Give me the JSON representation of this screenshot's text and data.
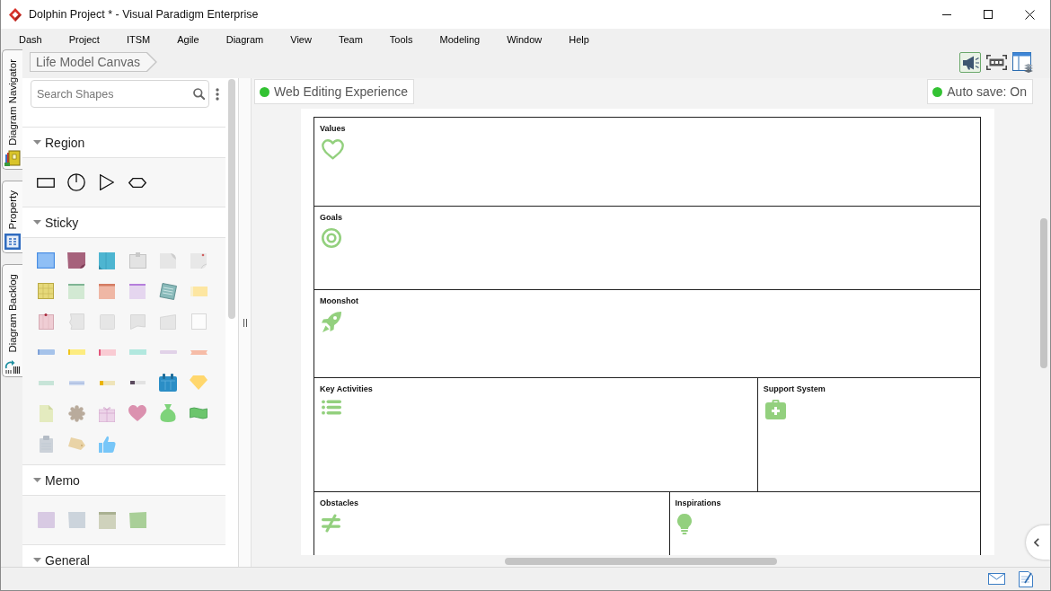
{
  "window": {
    "title": "Dolphin Project * - Visual Paradigm Enterprise"
  },
  "menu": [
    "Dash",
    "Project",
    "ITSM",
    "Agile",
    "Diagram",
    "View",
    "Team",
    "Tools",
    "Modeling",
    "Window",
    "Help"
  ],
  "side_tabs": [
    {
      "label": "Diagram Navigator",
      "selected": false
    },
    {
      "label": "Property",
      "selected": false
    },
    {
      "label": "Diagram Backlog",
      "selected": false
    }
  ],
  "breadcrumb": [
    "Life Model Canvas"
  ],
  "toolbar": [
    {
      "on": true
    },
    {
      "on": false
    },
    {
      "on": false
    }
  ],
  "palette": {
    "search": {
      "placeholder": "Search Shapes"
    },
    "sections": [
      {
        "title": "Region",
        "kind": "region",
        "expanded": true
      },
      {
        "title": "Sticky",
        "kind": "sticky",
        "expanded": true
      },
      {
        "title": "Memo",
        "kind": "memo",
        "expanded": true
      },
      {
        "title": "General",
        "kind": "general",
        "expanded": true
      }
    ]
  },
  "canvas": {
    "web_editing": {
      "label": "Web Editing Experience"
    },
    "auto_save": {
      "label": "Auto save: On"
    },
    "rows": [
      {
        "regions": [
          {
            "title": "Values"
          }
        ]
      },
      {
        "regions": [
          {
            "title": "Goals"
          }
        ]
      },
      {
        "regions": [
          {
            "title": "Moonshot"
          }
        ]
      },
      {
        "regions": [
          {
            "title": "Key Activities"
          },
          {
            "title": "Support System"
          }
        ]
      },
      {
        "regions": [
          {
            "title": "Obstacles"
          },
          {
            "title": "Inspirations"
          }
        ]
      }
    ]
  }
}
